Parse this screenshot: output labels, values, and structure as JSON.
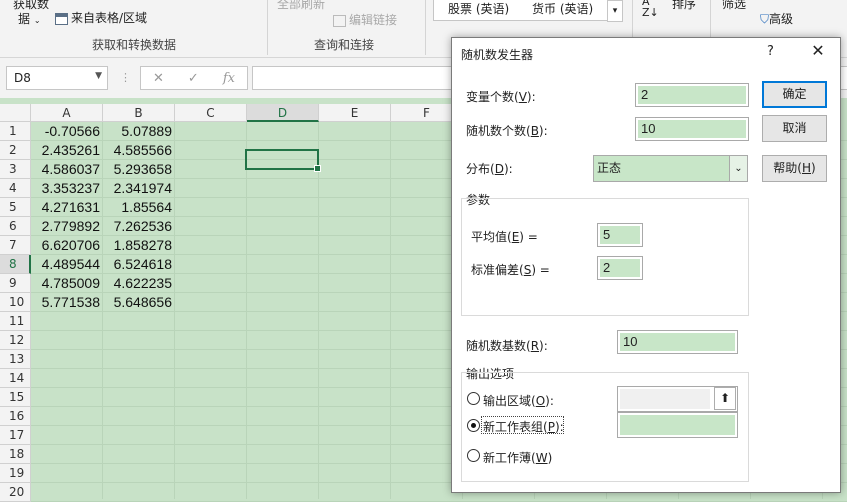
{
  "ribbon": {
    "get_data_line1": "获取数",
    "get_data_line2": "据",
    "from_table": "来自表格/区域",
    "group_get_transform": "获取和转换数据",
    "refresh_all": "全部刷新",
    "edit_links": "编辑链接",
    "group_queries": "查询和连接",
    "stocks": "股票 (英语)",
    "currency": "货币 (英语)",
    "sort": "排序",
    "filter": "筛选",
    "advanced": "高级"
  },
  "formula_bar": {
    "name_box": "D8",
    "fx": "fx",
    "formula": ""
  },
  "sheet": {
    "columns": [
      "A",
      "B",
      "C",
      "D",
      "E",
      "F"
    ],
    "selected_column": "D",
    "rows": [
      "1",
      "2",
      "3",
      "4",
      "5",
      "6",
      "7",
      "8",
      "9",
      "10",
      "11",
      "12",
      "13",
      "14",
      "15",
      "16",
      "17",
      "18",
      "19",
      "20"
    ],
    "selected_row": "8",
    "col_a": [
      "-0.70566",
      "2.435261",
      "4.586037",
      "3.353237",
      "4.271631",
      "2.779892",
      "6.620706",
      "4.489544",
      "4.785009",
      "5.771538"
    ],
    "col_b": [
      "5.07889",
      "4.585566",
      "5.293658",
      "2.341974",
      "1.85564",
      "7.262536",
      "1.858278",
      "6.524618",
      "4.622235",
      "5.648656"
    ]
  },
  "dialog": {
    "title": "随机数发生器",
    "help_glyph": "?",
    "close_glyph": "✕",
    "num_vars_pre": "变量个数(",
    "num_vars_key": "V",
    "num_vars_post": "):",
    "num_vars": "2",
    "num_rand_pre": "随机数个数(",
    "num_rand_key": "B",
    "num_rand_post": "):",
    "num_rand": "10",
    "dist_pre": "分布(",
    "dist_key": "D",
    "dist_post": "):",
    "dist_value": "正态",
    "params_label": "参数",
    "mean_pre": "平均值(",
    "mean_key": "E",
    "mean_post": ") =",
    "mean": "5",
    "sd_pre": "标准偏差(",
    "sd_key": "S",
    "sd_post": ") =",
    "sd": "2",
    "seed_pre": "随机数基数(",
    "seed_key": "R",
    "seed_post": "):",
    "seed": "10",
    "output_label": "输出选项",
    "opt_range_pre": "输出区域(",
    "opt_range_key": "O",
    "opt_range_post": "):",
    "opt_sheet_pre": "新工作表组(",
    "opt_sheet_key": "P",
    "opt_sheet_post": "):",
    "opt_book_pre": "新工作薄(",
    "opt_book_key": "W",
    "opt_book_post": ")",
    "selected_output": "新工作表组",
    "ok_label": "确定",
    "cancel_label": "取消",
    "help_pre": "帮助(",
    "help_key": "H",
    "help_post": ")"
  }
}
